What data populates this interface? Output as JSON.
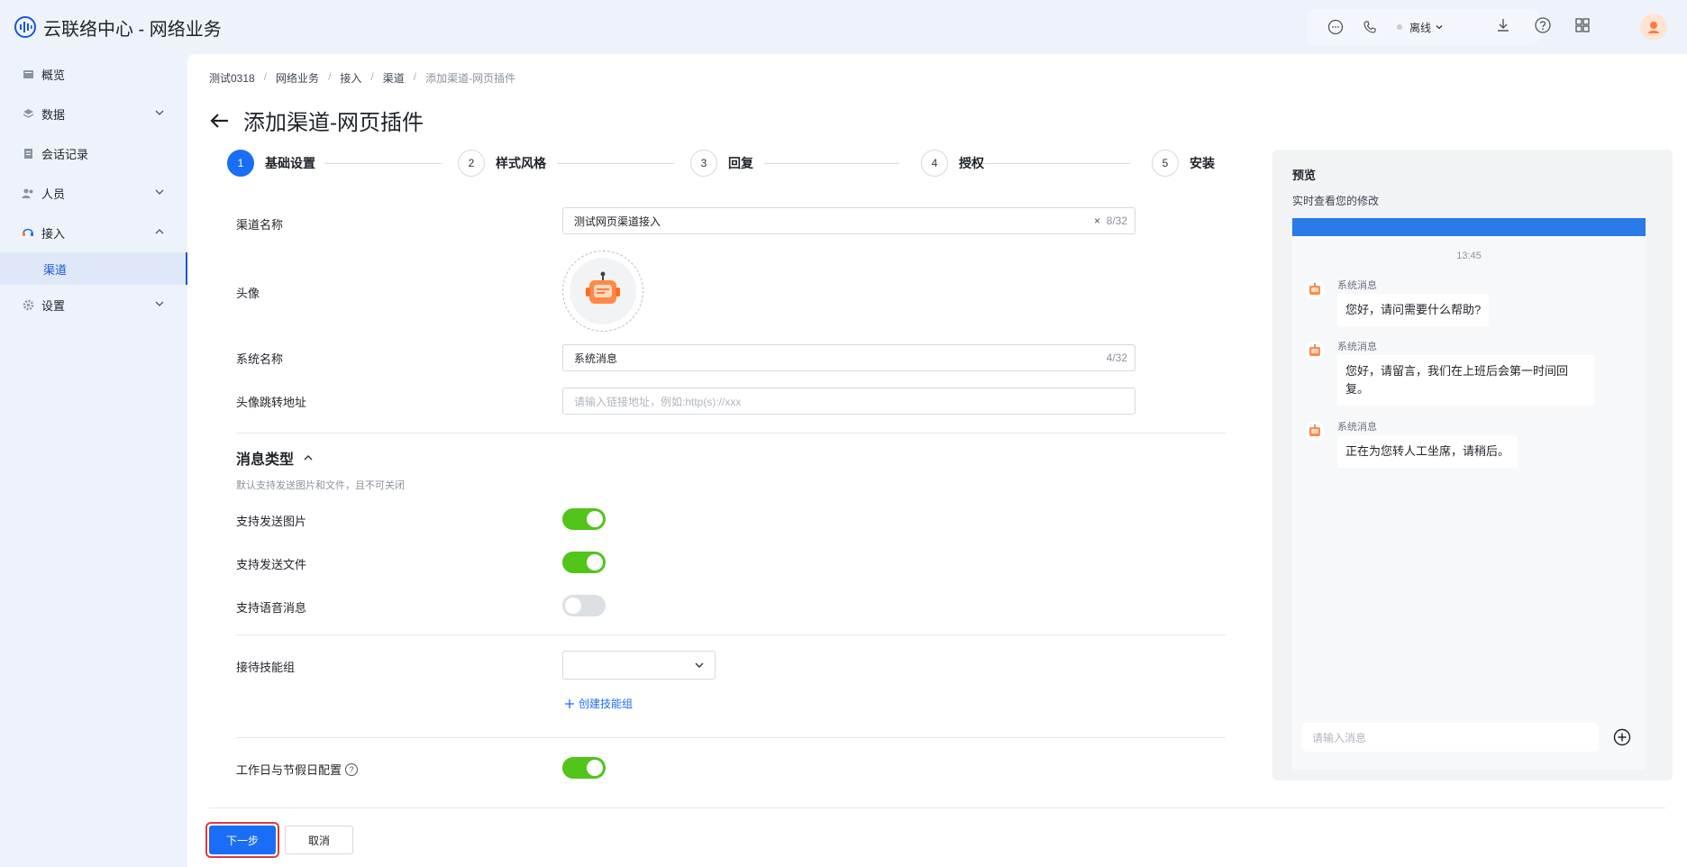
{
  "app": {
    "title": "云联络中心 - 网络业务"
  },
  "topbar": {
    "status_label": "离线",
    "icons": [
      "chat-bubble-icon",
      "phone-icon",
      "download-icon",
      "help-icon",
      "apps-grid-icon",
      "user-avatar"
    ]
  },
  "sidebar": {
    "items": [
      {
        "label": "概览",
        "icon": "overview-icon"
      },
      {
        "label": "数据",
        "icon": "data-icon",
        "expandable": true
      },
      {
        "label": "会话记录",
        "icon": "records-icon"
      },
      {
        "label": "人员",
        "icon": "people-icon",
        "expandable": true
      },
      {
        "label": "接入",
        "icon": "headset-icon",
        "expanded": true
      },
      {
        "label": "设置",
        "icon": "settings-icon",
        "expandable": true
      }
    ],
    "sub_items": [
      {
        "label": "渠道",
        "active": true
      }
    ]
  },
  "breadcrumb": [
    "测试0318",
    "网络业务",
    "接入",
    "渠道",
    "添加渠道-网页插件"
  ],
  "page": {
    "title": "添加渠道-网页插件"
  },
  "steps": [
    {
      "num": "1",
      "label": "基础设置",
      "active": true
    },
    {
      "num": "2",
      "label": "样式风格"
    },
    {
      "num": "3",
      "label": "回复"
    },
    {
      "num": "4",
      "label": "授权"
    },
    {
      "num": "5",
      "label": "安装"
    }
  ],
  "form": {
    "channel_name": {
      "label": "渠道名称",
      "value": "测试网页渠道接入",
      "counter": "8/32",
      "clear": "×"
    },
    "avatar": {
      "label": "头像"
    },
    "system_name": {
      "label": "系统名称",
      "value": "系统消息",
      "counter": "4/32"
    },
    "avatar_url": {
      "label": "头像跳转地址",
      "placeholder": "请输入链接地址，例如:http(s)://xxx"
    },
    "message_type": {
      "title": "消息类型",
      "desc": "默认支持发送图片和文件，且不可关闭",
      "toggles": [
        {
          "label": "支持发送图片",
          "on": true
        },
        {
          "label": "支持发送文件",
          "on": true
        },
        {
          "label": "支持语音消息",
          "on": false
        }
      ]
    },
    "skill_group": {
      "label": "接待技能组",
      "value": "",
      "create_link": "创建技能组"
    },
    "workday": {
      "label": "工作日与节假日配置",
      "on": true
    }
  },
  "footer": {
    "next": "下一步",
    "cancel": "取消"
  },
  "preview": {
    "title": "预览",
    "desc": "实时查看您的修改",
    "time": "13:45",
    "messages": [
      {
        "sender": "系统消息",
        "text": "您好，请问需要什么帮助?"
      },
      {
        "sender": "系统消息",
        "text": "您好，请留言，我们在上班后会第一时间回复。"
      },
      {
        "sender": "系统消息",
        "text": "正在为您转人工坐席，请稍后。"
      }
    ],
    "input_placeholder": "请输入消息"
  },
  "colors": {
    "primary": "#1a6ef5",
    "toggle_on": "#52c41a",
    "highlight": "#e03a3a",
    "chat_header": "#2a7ae8"
  }
}
